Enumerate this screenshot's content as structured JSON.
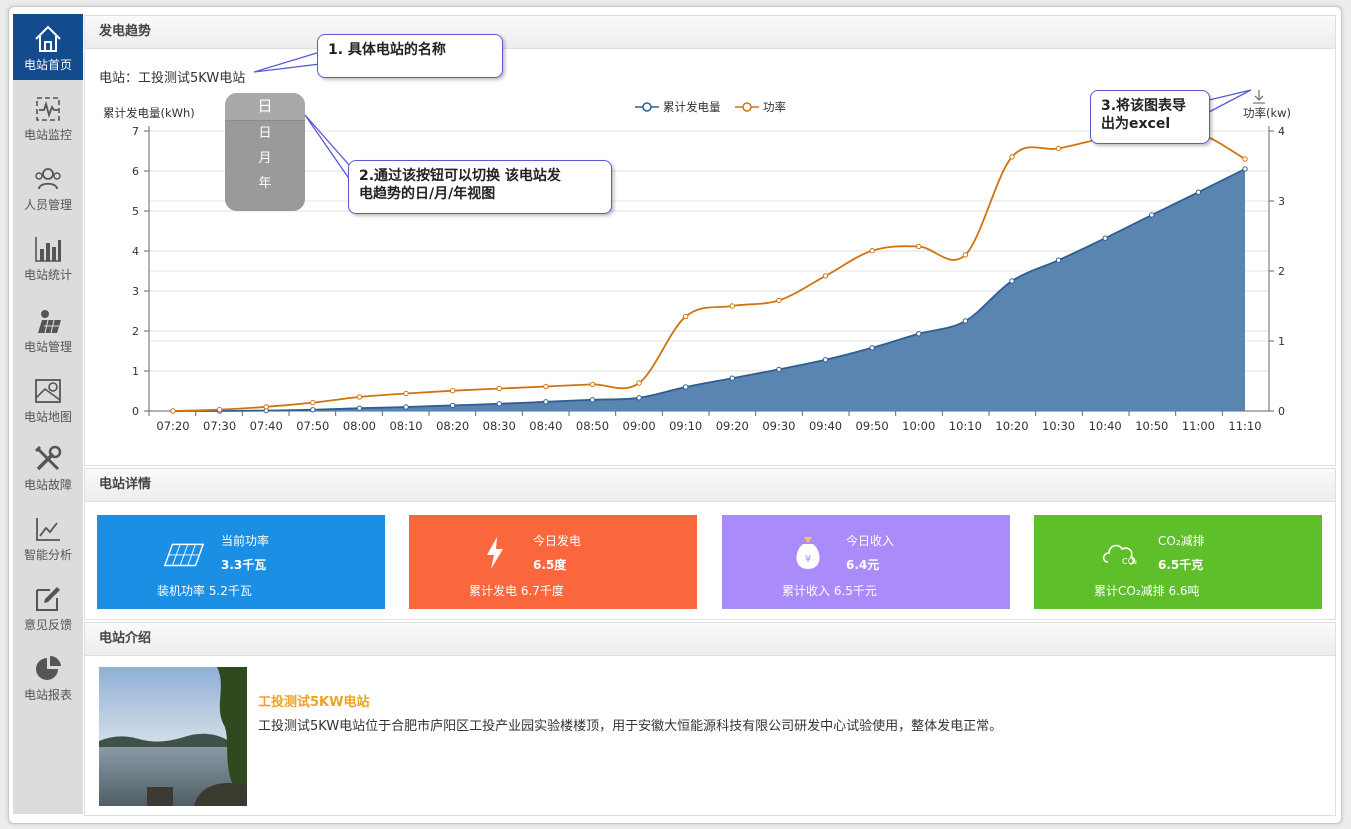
{
  "nav": {
    "items": [
      {
        "label": "电站首页",
        "icon": "home-icon"
      },
      {
        "label": "电站监控",
        "icon": "monitor-icon"
      },
      {
        "label": "人员管理",
        "icon": "people-icon"
      },
      {
        "label": "电站统计",
        "icon": "bar-stats-icon"
      },
      {
        "label": "电站管理",
        "icon": "solar-panel-icon"
      },
      {
        "label": "电站地图",
        "icon": "map-icon"
      },
      {
        "label": "电站故障",
        "icon": "tools-icon"
      },
      {
        "label": "智能分析",
        "icon": "analysis-icon"
      },
      {
        "label": "意见反馈",
        "icon": "feedback-edit-icon"
      },
      {
        "label": "电站报表",
        "icon": "pie-report-icon"
      }
    ]
  },
  "trend": {
    "header": "发电趋势",
    "station_label": "电站：",
    "station_name": "工投测试5KW电站",
    "period_selected": "日",
    "period_options": [
      "日",
      "月",
      "年"
    ],
    "export_icon": "download-icon"
  },
  "callouts": {
    "c1": "1. 具体电站的名称",
    "c2_line1": "2.通过该按钮可以切换 该电站发",
    "c2_line2": "电趋势的日/月/年视图",
    "c3_line1": "3.将该图表导",
    "c3_line2": "出为excel"
  },
  "chart_data": {
    "type": "line",
    "x": [
      "07:20",
      "07:30",
      "07:40",
      "07:50",
      "08:00",
      "08:10",
      "08:20",
      "08:30",
      "08:40",
      "08:50",
      "09:00",
      "09:10",
      "09:20",
      "09:30",
      "09:40",
      "09:50",
      "10:00",
      "10:10",
      "10:20",
      "10:30",
      "10:40",
      "10:50",
      "11:00",
      "11:10"
    ],
    "series": [
      {
        "name": "累计发电量",
        "axis": "left",
        "style": "area",
        "color": "#2f5f92",
        "values": [
          0,
          0,
          0.01,
          0.03,
          0.07,
          0.1,
          0.14,
          0.18,
          0.23,
          0.28,
          0.33,
          0.6,
          0.82,
          1.04,
          1.28,
          1.58,
          1.93,
          2.25,
          3.25,
          3.77,
          4.32,
          4.9,
          5.47,
          6.05
        ]
      },
      {
        "name": "功率",
        "axis": "right",
        "style": "line",
        "color": "#d0730f",
        "values": [
          0,
          0.02,
          0.06,
          0.12,
          0.2,
          0.25,
          0.29,
          0.32,
          0.35,
          0.38,
          0.4,
          1.35,
          1.5,
          1.58,
          1.93,
          2.29,
          2.35,
          2.23,
          3.63,
          3.75,
          3.9,
          4.0,
          3.97,
          3.6
        ]
      }
    ],
    "ylabel_left": "累计发电量(kWh)",
    "ylabel_right": "功率(kw)",
    "ylim_left": [
      0,
      7
    ],
    "ylim_right": [
      0,
      4
    ],
    "yticks_left": [
      0,
      1,
      2,
      3,
      4,
      5,
      6,
      7
    ],
    "yticks_right": [
      0,
      1,
      2,
      3,
      4
    ],
    "grid": true,
    "legend": "top-center"
  },
  "details": {
    "header": "电站详情",
    "cards": [
      {
        "title": "当前功率",
        "value": "3.3千瓦",
        "footer": "装机功率 5.2千瓦",
        "color": "#1a8fe3",
        "icon": "solar-panel-icon"
      },
      {
        "title": "今日发电",
        "value": "6.5度",
        "footer": "累计发电 6.7千度",
        "color": "#fb673d",
        "icon": "lightning-icon"
      },
      {
        "title": "今日收入",
        "value": "6.4元",
        "footer": "累计收入 6.5千元",
        "color": "#a98bfa",
        "icon": "money-bag-icon"
      },
      {
        "title": "CO₂减排",
        "value": "6.5千克",
        "footer": "累计CO₂减排 6.6吨",
        "color": "#5fbf2b",
        "icon": "co2-cloud-icon"
      }
    ]
  },
  "intro": {
    "header": "电站介绍",
    "title": "工投测试5KW电站",
    "description": "工投测试5KW电站位于合肥市庐阳区工投产业园实验楼楼顶，用于安徽大恒能源科技有限公司研发中心试验使用，整体发电正常。"
  }
}
